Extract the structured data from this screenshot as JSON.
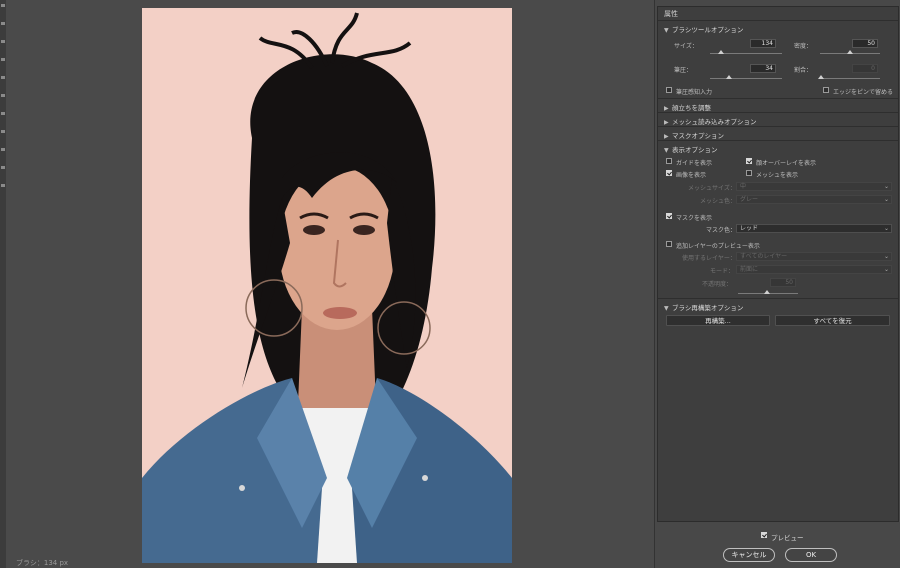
{
  "panel": {
    "title": "属性"
  },
  "brush": {
    "header": "ブラシツールオプション",
    "size_label": "サイズ：",
    "size_value": "134",
    "density_label": "密度：",
    "density_value": "50",
    "pressure_label": "筆圧：",
    "pressure_value": "34",
    "rate_label": "割合：",
    "rate_value": "0",
    "stylus_label": "筆圧感知入力",
    "pin_edges_label": "エッジをピンで留める"
  },
  "sections": {
    "face": "顔立ちを調整",
    "mesh_load": "メッシュ読み込みオプション",
    "mask_options": "マスクオプション"
  },
  "view": {
    "header": "表示オプション",
    "show_guides": "ガイドを表示",
    "show_face_overlay": "顔オーバーレイを表示",
    "show_image": "画像を表示",
    "show_mesh": "メッシュを表示",
    "mesh_size_label": "メッシュサイズ：",
    "mesh_size_value": "中",
    "mesh_color_label": "メッシュ色：",
    "mesh_color_value": "グレー",
    "show_mask": "マスクを表示",
    "mask_color_label": "マスク色：",
    "mask_color_value": "レッド",
    "backdrop_label": "追加レイヤーのプレビュー表示",
    "use_label": "使用するレイヤー：",
    "use_value": "すべてのレイヤー",
    "mode_label": "モード：",
    "mode_value": "前面に",
    "opacity_label": "不透明度：",
    "opacity_value": "50"
  },
  "reconstruct": {
    "header": "ブラシ再構築オプション",
    "reconstruct_button": "再構築...",
    "restore_all_button": "すべてを復元"
  },
  "footer": {
    "preview_label": "プレビュー",
    "cancel_button": "キャンセル",
    "ok_button": "OK"
  },
  "status": {
    "text": "ブラシ：134 px"
  }
}
